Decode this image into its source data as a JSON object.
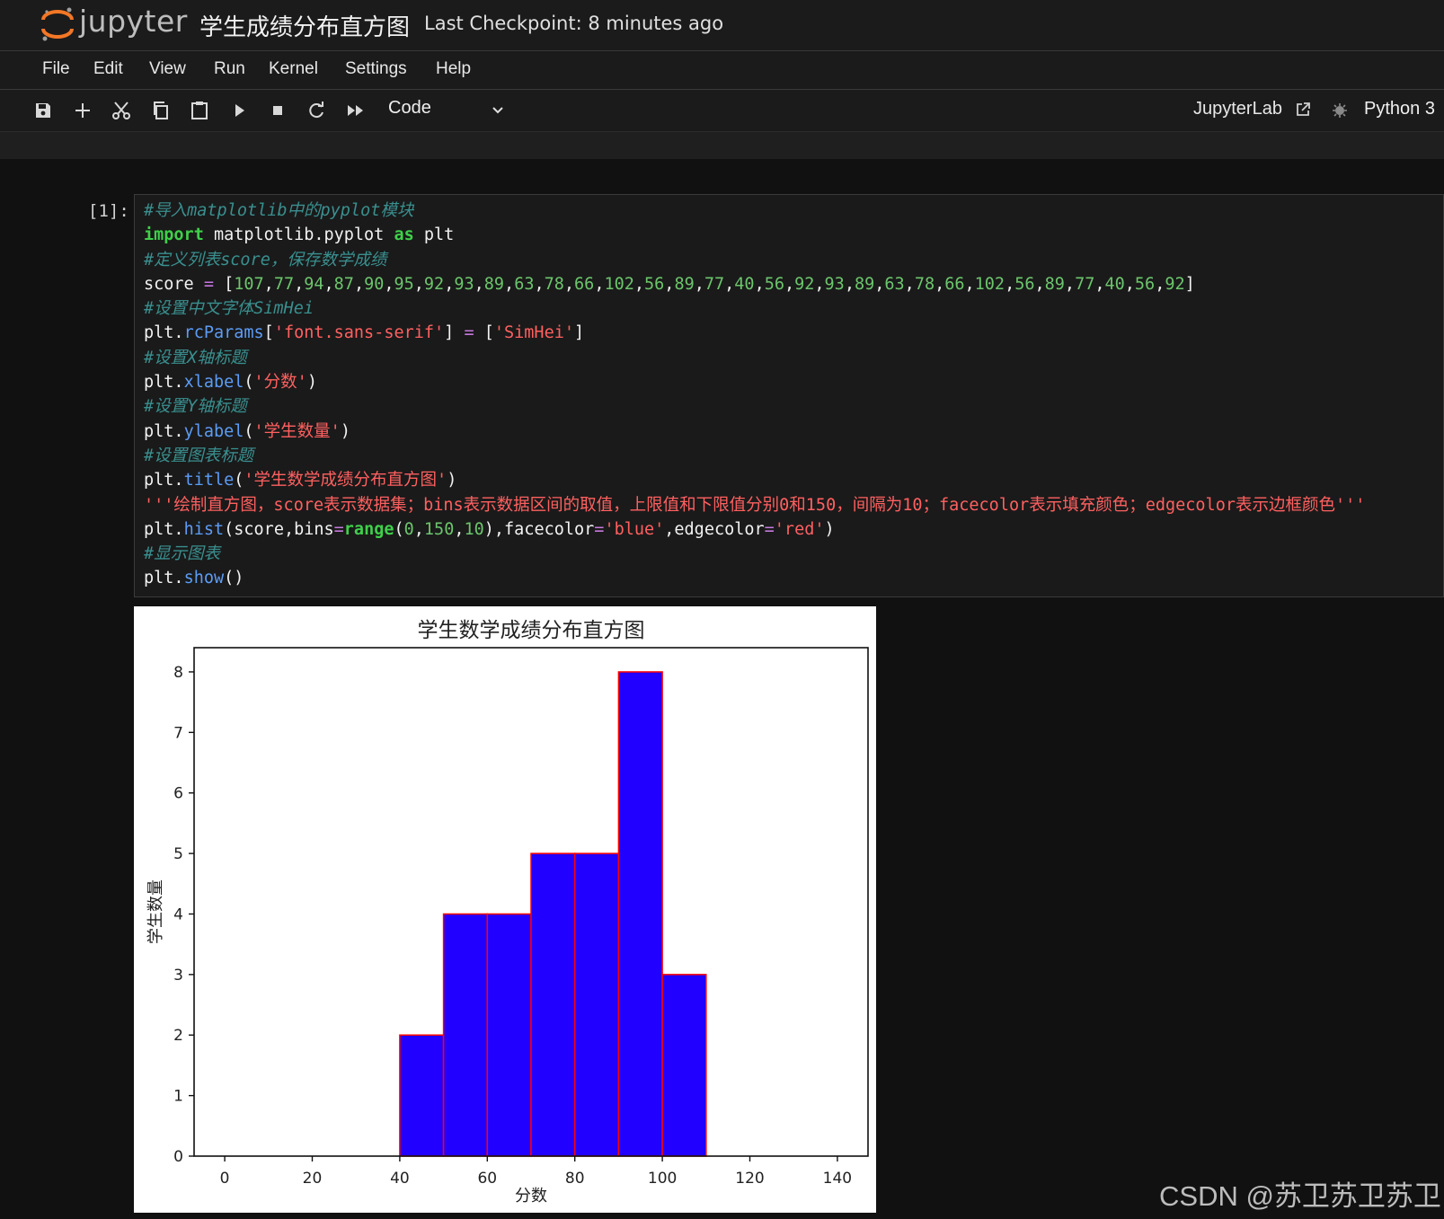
{
  "header": {
    "brand": "jupyter",
    "notebook_title": "学生成绩分布直方图",
    "checkpoint": "Last Checkpoint: 8 minutes ago"
  },
  "menu": [
    "File",
    "Edit",
    "View",
    "Run",
    "Kernel",
    "Settings",
    "Help"
  ],
  "toolbar": {
    "buttons": [
      "save-icon",
      "add-cell-icon",
      "cut-icon",
      "copy-icon",
      "paste-icon",
      "run-icon",
      "stop-icon",
      "restart-icon",
      "fast-forward-icon"
    ],
    "cell_type": "Code",
    "open_in": "JupyterLab",
    "kernel": "Python 3"
  },
  "cell": {
    "prompt": "[1]:",
    "code_lines": [
      [
        [
          "c-comment",
          "#导入matplotlib中的pyplot模块"
        ]
      ],
      [
        [
          "c-kw",
          "import"
        ],
        [
          "c-plain",
          " matplotlib.pyplot "
        ],
        [
          "c-kw",
          "as"
        ],
        [
          "c-plain",
          " plt"
        ]
      ],
      [
        [
          "c-comment",
          "#定义列表score，保存数学成绩"
        ]
      ],
      [
        [
          "c-plain",
          "score "
        ],
        [
          "c-op",
          "="
        ],
        [
          "c-plain",
          " ["
        ],
        [
          "c-num",
          "107"
        ],
        [
          "c-plain",
          ","
        ],
        [
          "c-num",
          "77"
        ],
        [
          "c-plain",
          ","
        ],
        [
          "c-num",
          "94"
        ],
        [
          "c-plain",
          ","
        ],
        [
          "c-num",
          "87"
        ],
        [
          "c-plain",
          ","
        ],
        [
          "c-num",
          "90"
        ],
        [
          "c-plain",
          ","
        ],
        [
          "c-num",
          "95"
        ],
        [
          "c-plain",
          ","
        ],
        [
          "c-num",
          "92"
        ],
        [
          "c-plain",
          ","
        ],
        [
          "c-num",
          "93"
        ],
        [
          "c-plain",
          ","
        ],
        [
          "c-num",
          "89"
        ],
        [
          "c-plain",
          ","
        ],
        [
          "c-num",
          "63"
        ],
        [
          "c-plain",
          ","
        ],
        [
          "c-num",
          "78"
        ],
        [
          "c-plain",
          ","
        ],
        [
          "c-num",
          "66"
        ],
        [
          "c-plain",
          ","
        ],
        [
          "c-num",
          "102"
        ],
        [
          "c-plain",
          ","
        ],
        [
          "c-num",
          "56"
        ],
        [
          "c-plain",
          ","
        ],
        [
          "c-num",
          "89"
        ],
        [
          "c-plain",
          ","
        ],
        [
          "c-num",
          "77"
        ],
        [
          "c-plain",
          ","
        ],
        [
          "c-num",
          "40"
        ],
        [
          "c-plain",
          ","
        ],
        [
          "c-num",
          "56"
        ],
        [
          "c-plain",
          ","
        ],
        [
          "c-num",
          "92"
        ],
        [
          "c-plain",
          ","
        ],
        [
          "c-num",
          "93"
        ],
        [
          "c-plain",
          ","
        ],
        [
          "c-num",
          "89"
        ],
        [
          "c-plain",
          ","
        ],
        [
          "c-num",
          "63"
        ],
        [
          "c-plain",
          ","
        ],
        [
          "c-num",
          "78"
        ],
        [
          "c-plain",
          ","
        ],
        [
          "c-num",
          "66"
        ],
        [
          "c-plain",
          ","
        ],
        [
          "c-num",
          "102"
        ],
        [
          "c-plain",
          ","
        ],
        [
          "c-num",
          "56"
        ],
        [
          "c-plain",
          ","
        ],
        [
          "c-num",
          "89"
        ],
        [
          "c-plain",
          ","
        ],
        [
          "c-num",
          "77"
        ],
        [
          "c-plain",
          ","
        ],
        [
          "c-num",
          "40"
        ],
        [
          "c-plain",
          ","
        ],
        [
          "c-num",
          "56"
        ],
        [
          "c-plain",
          ","
        ],
        [
          "c-num",
          "92"
        ],
        [
          "c-plain",
          "]"
        ]
      ],
      [
        [
          "c-comment",
          "#设置中文字体SimHei"
        ]
      ],
      [
        [
          "c-plain",
          "plt."
        ],
        [
          "c-fn",
          "rcParams"
        ],
        [
          "c-plain",
          "["
        ],
        [
          "c-str",
          "'font.sans-serif'"
        ],
        [
          "c-plain",
          "] "
        ],
        [
          "c-op",
          "="
        ],
        [
          "c-plain",
          " ["
        ],
        [
          "c-str",
          "'SimHei'"
        ],
        [
          "c-plain",
          "]"
        ]
      ],
      [
        [
          "c-comment",
          "#设置X轴标题"
        ]
      ],
      [
        [
          "c-plain",
          "plt."
        ],
        [
          "c-fn",
          "xlabel"
        ],
        [
          "c-plain",
          "("
        ],
        [
          "c-str",
          "'分数'"
        ],
        [
          "c-plain",
          ")"
        ]
      ],
      [
        [
          "c-comment",
          "#设置Y轴标题"
        ]
      ],
      [
        [
          "c-plain",
          "plt."
        ],
        [
          "c-fn",
          "ylabel"
        ],
        [
          "c-plain",
          "("
        ],
        [
          "c-str",
          "'学生数量'"
        ],
        [
          "c-plain",
          ")"
        ]
      ],
      [
        [
          "c-comment",
          "#设置图表标题"
        ]
      ],
      [
        [
          "c-plain",
          "plt."
        ],
        [
          "c-fn",
          "title"
        ],
        [
          "c-plain",
          "("
        ],
        [
          "c-str",
          "'学生数学成绩分布直方图'"
        ],
        [
          "c-plain",
          ")"
        ]
      ],
      [
        [
          "c-str",
          "'''绘制直方图，score表示数据集；bins表示数据区间的取值，上限值和下限值分别0和150，间隔为10；facecolor表示填充颜色；edgecolor表示边框颜色'''"
        ]
      ],
      [
        [
          "c-plain",
          "plt."
        ],
        [
          "c-fn",
          "hist"
        ],
        [
          "c-plain",
          "(score,bins"
        ],
        [
          "c-op",
          "="
        ],
        [
          "c-kw",
          "range"
        ],
        [
          "c-plain",
          "("
        ],
        [
          "c-num",
          "0"
        ],
        [
          "c-plain",
          ","
        ],
        [
          "c-num",
          "150"
        ],
        [
          "c-plain",
          ","
        ],
        [
          "c-num",
          "10"
        ],
        [
          "c-plain",
          "),facecolor"
        ],
        [
          "c-op",
          "="
        ],
        [
          "c-str",
          "'blue'"
        ],
        [
          "c-plain",
          ",edgecolor"
        ],
        [
          "c-op",
          "="
        ],
        [
          "c-str",
          "'red'"
        ],
        [
          "c-plain",
          ")"
        ]
      ],
      [
        [
          "c-comment",
          "#显示图表"
        ]
      ],
      [
        [
          "c-plain",
          "plt."
        ],
        [
          "c-fn",
          "show"
        ],
        [
          "c-plain",
          "()"
        ]
      ]
    ]
  },
  "chart_data": {
    "type": "bar",
    "title": "学生数学成绩分布直方图",
    "xlabel": "分数",
    "ylabel": "学生数量",
    "bin_edges": [
      0,
      10,
      20,
      30,
      40,
      50,
      60,
      70,
      80,
      90,
      100,
      110,
      120,
      130,
      140
    ],
    "values": [
      0,
      0,
      0,
      0,
      2,
      4,
      4,
      5,
      5,
      8,
      3,
      0,
      0,
      0
    ],
    "xticks": [
      0,
      20,
      40,
      60,
      80,
      100,
      120,
      140
    ],
    "yticks": [
      0,
      1,
      2,
      3,
      4,
      5,
      6,
      7,
      8
    ],
    "xlim": [
      -7,
      147
    ],
    "ylim": [
      0,
      8.4
    ],
    "facecolor": "#2200ff",
    "edgecolor": "#ff0000",
    "grid": false
  },
  "watermark": "CSDN @苏卫苏卫苏卫"
}
